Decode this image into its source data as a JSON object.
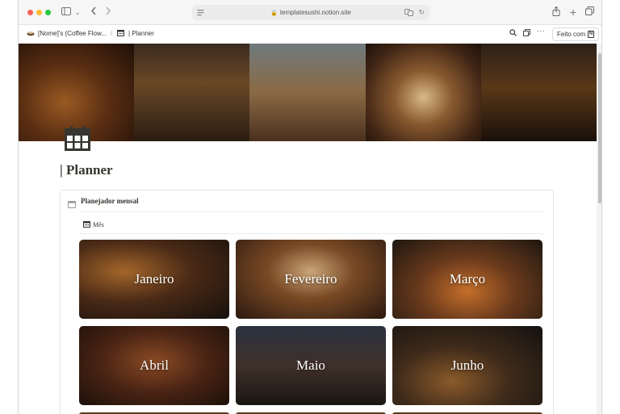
{
  "browser": {
    "url": "templatesushi.notion.site"
  },
  "notion_bar": {
    "breadcrumb_page": "[Nome]'s (Coffee Flow...",
    "breadcrumb_sep": "/",
    "breadcrumb_current": "| Planner",
    "feito_com_label": "Feito com",
    "notion_logo_letter": "N"
  },
  "page": {
    "title": "| Planner"
  },
  "callout": {
    "title": "Planejador mensal",
    "view_tab_label": "Mês"
  },
  "gallery": {
    "cards": [
      {
        "label": "Janeiro"
      },
      {
        "label": "Fevereiro"
      },
      {
        "label": "Março"
      },
      {
        "label": "Abril"
      },
      {
        "label": "Maio"
      },
      {
        "label": "Junho"
      }
    ]
  },
  "colors": {
    "text": "#37352f",
    "traffic_red": "#fe5f57",
    "traffic_yellow": "#febc2e",
    "traffic_green": "#28c840"
  }
}
